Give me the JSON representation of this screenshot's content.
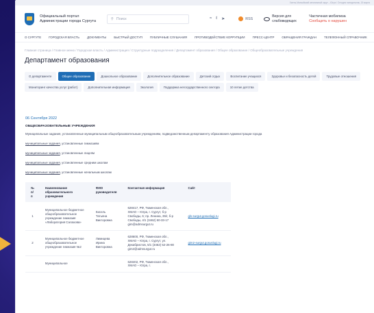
{
  "topstrip": "Ханты-Мансийский автономный округ – Югра / Сегодня понедельник, 15 марта",
  "header": {
    "portal_name": "Официальный портал Администрации города Сургута",
    "search_placeholder": "Поиск",
    "icons": [
      "vk-icon",
      "ok-icon",
      "telegram-icon"
    ],
    "rss": "RSS",
    "blind_version": "Версия для слабовидящих",
    "mobilization_line1": "Частичная мобилиза",
    "mobilization_line2": "Сообщить о нарушен"
  },
  "nav": [
    "О СУРГУТЕ",
    "ГОРОДСКАЯ ВЛАСТЬ",
    "ДОКУМЕНТЫ",
    "БЫСТРЫЙ ДОСТУП",
    "ПУБЛИЧНЫЕ СЛУШАНИЯ",
    "ПРОТИВОДЕЙСТВИЕ КОРРУПЦИИ",
    "ПРЕСС-ЦЕНТР",
    "ОБРАЩЕНИЯ ГРАЖДАН",
    "ТЕЛЕФОННЫЙ СПРАВОЧНИК"
  ],
  "breadcrumbs": "Главная страница / Главное меню / Городская власть / Администрация / Структурные подразделения / Департамент образования / Общее образование / Общеобразовательные учреждения",
  "page_title": "Департамент образования",
  "tabs": [
    {
      "label": "О департаменте",
      "active": false
    },
    {
      "label": "Общее образование",
      "active": true
    },
    {
      "label": "Дошкольное образование",
      "active": false
    },
    {
      "label": "Дополнительное образование",
      "active": false
    },
    {
      "label": "Детский отдых",
      "active": false
    },
    {
      "label": "Воспитание учащихся",
      "active": false
    },
    {
      "label": "Здоровье и безопасность детей",
      "active": false
    },
    {
      "label": "Трудовые отношения",
      "active": false
    },
    {
      "label": "Мониторинг качества услуг (работ)",
      "active": false
    },
    {
      "label": "Дополнительная информация",
      "active": false
    },
    {
      "label": "Экология",
      "active": false
    },
    {
      "label": "Поддержка негосударственного сектора",
      "active": false
    },
    {
      "label": "10 летие детства",
      "active": false
    }
  ],
  "content": {
    "date": "06 Сентября 2022",
    "section_title": "ОБЩЕОБРАЗОВАТЕЛЬНЫЕ УЧРЕЖДЕНИЯ",
    "intro": "Муниципальные задания, установленные муниципальным общеобразовательным учреждениям, подведомственным департаменту образования Администрации города",
    "doc_link_label": "муниципальные задания",
    "doc_lines": [
      ", установленные гимназиям",
      ", установленные лицеям",
      ", установленные средним школам",
      ", установленные начальным школам"
    ]
  },
  "table": {
    "headers": [
      "№ п/п",
      "Наименование образовательного учреждения",
      "ФИО руководителя",
      "Контактная информация",
      "Сайт"
    ],
    "rows": [
      {
        "num": "1",
        "name": "Муниципальное бюджетное общеобразовательное учреждение гимназия «Лаборатория Салахова»",
        "fio": "Кисель Татьяна Викторовна",
        "contact": "628417, РФ, Тюменская обл., ХМАО – Югра, г. Сургут, б-р Свободы, 6; пр. Ленина, 35/г, б-р Свободы, 4/1 (3462) 50-33-17 gim@admsurgut.ru",
        "site": "gls-surgut.gosuslugi.ru"
      },
      {
        "num": "2",
        "name": "Муниципальное бюджетное общеобразовательное учреждение гимназия №2",
        "fio": "Лимицева Ирина Викторовна",
        "contact": "628600, РФ, Тюменская обл., ХМАО – Югра, г. Сургут, ул. Декабристов, 5/1 (3462) 52-26-80 gim2@admsurgut.ru",
        "site": "gim2-surgut.gosuslugi.ru"
      },
      {
        "num": "",
        "name": "Муниципальное",
        "fio": "",
        "contact": "628402, РФ, Тюменская обл., ХМАО – Югра, г.",
        "site": ""
      }
    ]
  },
  "colors": {
    "accent": "#1e6db5",
    "alert": "#e2463a",
    "background_outer": "#1a1463",
    "arrow": "#f2b33c"
  }
}
